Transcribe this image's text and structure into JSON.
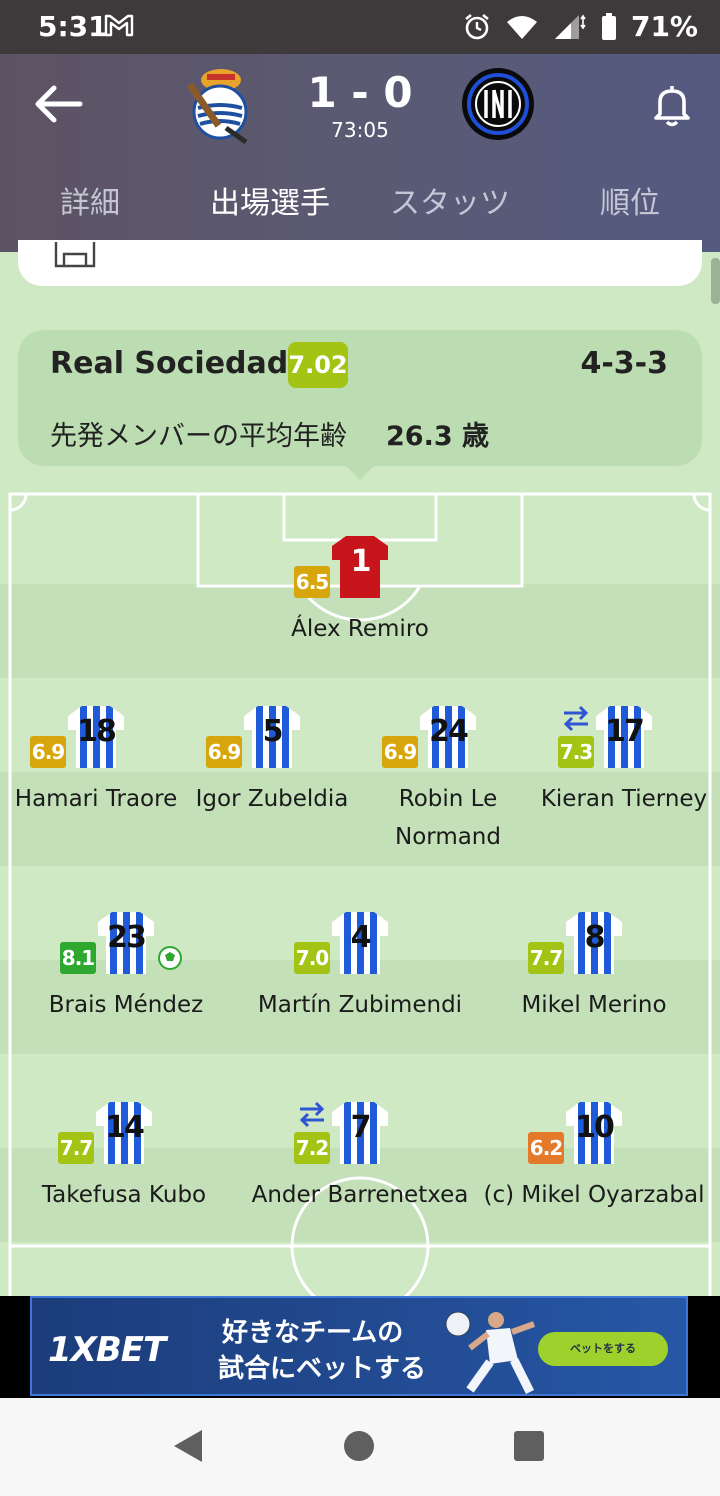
{
  "status_bar": {
    "time": "5:31",
    "battery": "71%",
    "icons": [
      "gmail-icon",
      "alarm-icon",
      "wifi-icon",
      "signal-icon",
      "battery-icon"
    ]
  },
  "header": {
    "score": "1 - 0",
    "match_time": "73:05",
    "home_crest": "real-sociedad-crest-icon",
    "away_crest": "inter-crest-icon"
  },
  "tabs": [
    {
      "label": "詳細",
      "active": false
    },
    {
      "label": "出場選手",
      "active": true
    },
    {
      "label": "スタッツ",
      "active": false
    },
    {
      "label": "順位",
      "active": false
    }
  ],
  "team": {
    "name": "Real Sociedad",
    "rating": "7.02",
    "formation": "4-3-3",
    "avg_age_label": "先発メンバーの平均年齢",
    "avg_age_value": "26.3 歳"
  },
  "lineup": {
    "goalkeeper": [
      {
        "number": "1",
        "name": "Álex Remiro",
        "rating": "6.5",
        "rating_color": "#d6a60c"
      }
    ],
    "defenders": [
      {
        "number": "18",
        "name": "Hamari Traore",
        "rating": "6.9",
        "rating_color": "#d6a60c"
      },
      {
        "number": "5",
        "name": "Igor Zubeldia",
        "rating": "6.9",
        "rating_color": "#d6a60c"
      },
      {
        "number": "24",
        "name": "Robin Le Normand",
        "rating": "6.9",
        "rating_color": "#d6a60c"
      },
      {
        "number": "17",
        "name": "Kieran Tierney",
        "rating": "7.3",
        "rating_color": "#a3c414",
        "substituted": true
      }
    ],
    "midfielders": [
      {
        "number": "23",
        "name": "Brais Méndez",
        "rating": "8.1",
        "rating_color": "#2ea82e",
        "goal": true
      },
      {
        "number": "4",
        "name": "Martín Zubimendi",
        "rating": "7.0",
        "rating_color": "#a3c414"
      },
      {
        "number": "8",
        "name": "Mikel Merino",
        "rating": "7.7",
        "rating_color": "#a3c414"
      }
    ],
    "forwards": [
      {
        "number": "14",
        "name": "Takefusa Kubo",
        "rating": "7.7",
        "rating_color": "#a3c414"
      },
      {
        "number": "7",
        "name": "Ander Barrenetxea",
        "rating": "7.2",
        "rating_color": "#a3c414",
        "substituted": true
      },
      {
        "number": "10",
        "name": "(c) Mikel Oyarzabal",
        "rating": "6.2",
        "rating_color": "#e27a2a"
      }
    ]
  },
  "ad": {
    "logo": "1XBET",
    "line1": "好きなチームの",
    "line2": "試合にベットする",
    "button": "ベットをする"
  },
  "colors": {
    "header_start": "#5d5363",
    "header_end": "#545a80",
    "pitch_light": "#cfe9c5",
    "pitch_dark": "#c3e0b8"
  }
}
